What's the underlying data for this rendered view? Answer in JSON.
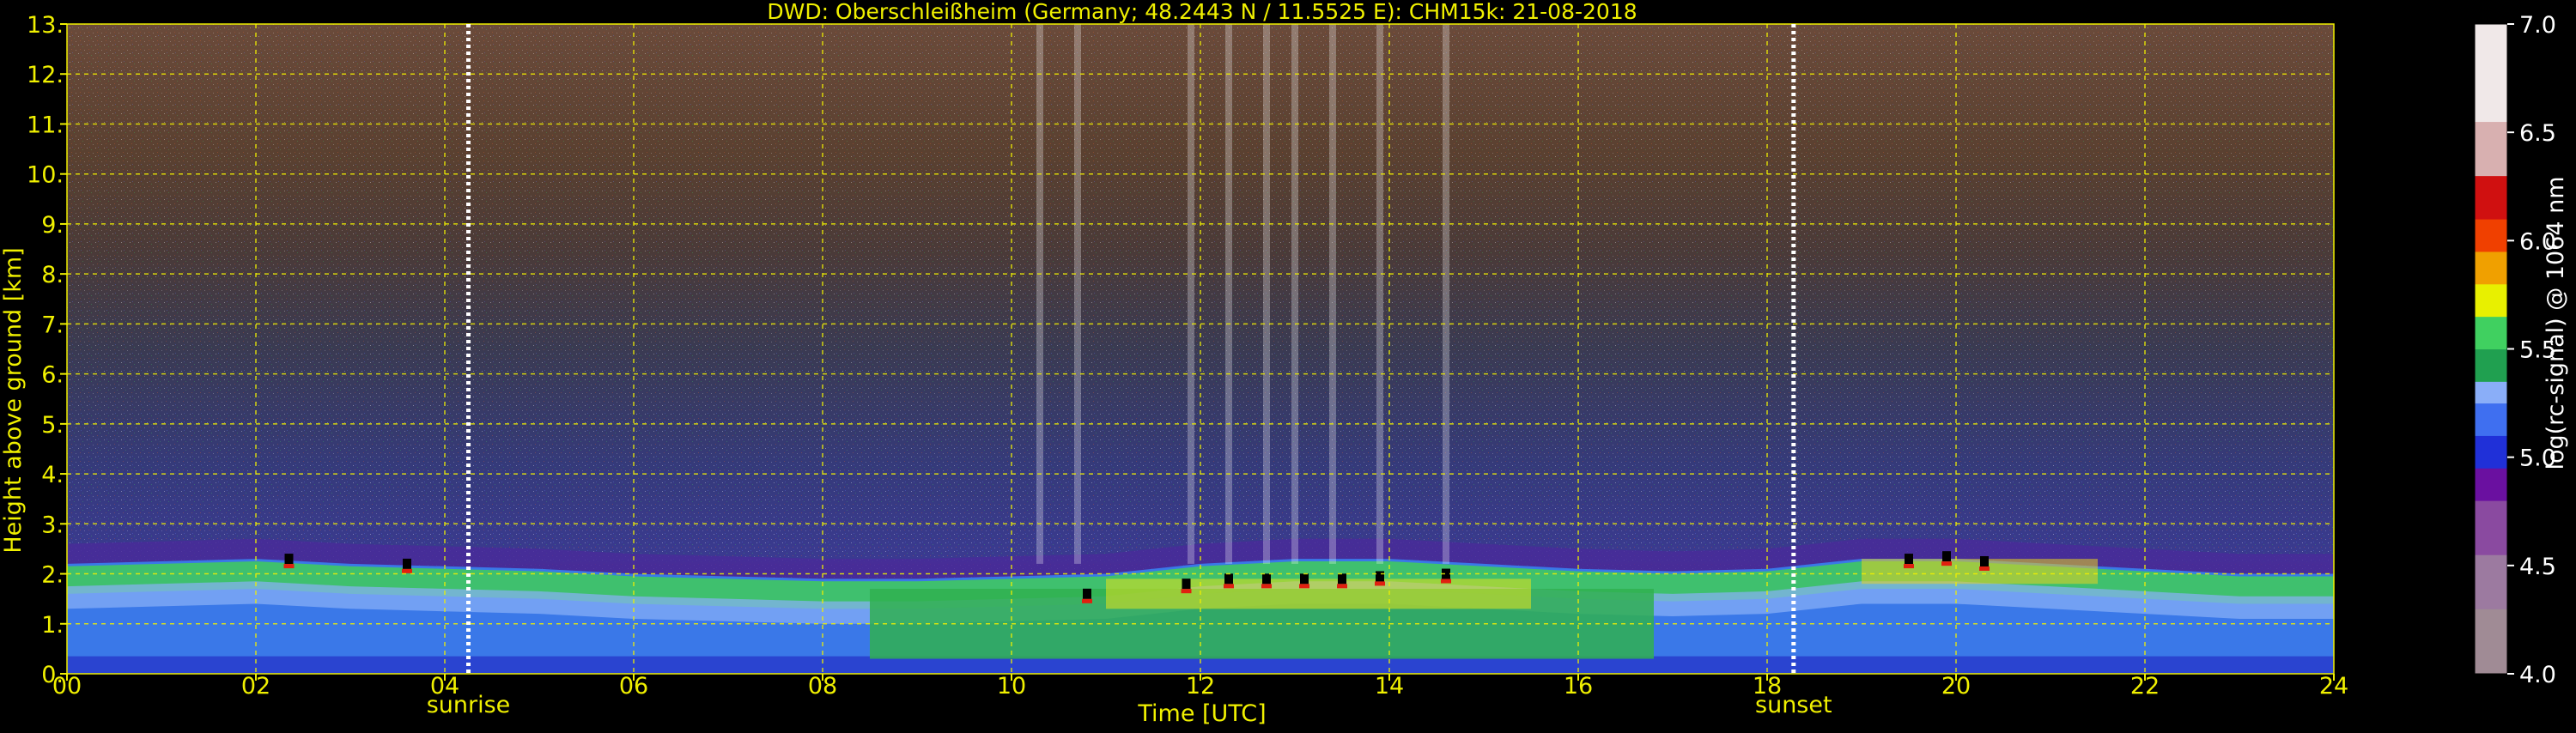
{
  "chart_data": {
    "type": "heatmap",
    "title": "DWD: Oberschleißheim (Germany; 48.2443 N / 11.5525 E):    CHM15k: 21-08-2018",
    "xlabel": "Time [UTC]",
    "ylabel": "Height above ground [km]",
    "x_range": [
      0,
      24
    ],
    "y_range": [
      0,
      13
    ],
    "x_tick_values": [
      0,
      2,
      4,
      6,
      8,
      10,
      12,
      14,
      16,
      18,
      20,
      22,
      24
    ],
    "x_tick_labels": [
      "00",
      "02",
      "04",
      "06",
      "08",
      "10",
      "12",
      "14",
      "16",
      "18",
      "20",
      "22",
      "24"
    ],
    "y_tick_values": [
      0,
      1,
      2,
      3,
      4,
      5,
      6,
      7,
      8,
      9,
      10,
      11,
      12,
      13
    ],
    "y_tick_labels": [
      "0.",
      "1.",
      "2.",
      "3.",
      "4.",
      "5.",
      "6.",
      "7.",
      "8.",
      "9.",
      "10.",
      "11.",
      "12.",
      "13."
    ],
    "grid": true,
    "annotations": [
      {
        "label": "sunrise",
        "x": 4.25
      },
      {
        "label": "sunset",
        "x": 18.28
      }
    ],
    "colorbar": {
      "label": "log(rc-signal) @ 1064 nm",
      "range": [
        4.0,
        7.0
      ],
      "tick_values": [
        4.0,
        4.5,
        5.0,
        5.5,
        6.0,
        6.5,
        7.0
      ],
      "tick_labels": [
        "4.0",
        "4.5",
        "5.0",
        "5.5",
        "6.0",
        "6.5",
        "7.0"
      ],
      "stops": [
        {
          "v": 4.0,
          "c": "#a08b95"
        },
        {
          "v": 4.3,
          "c": "#9c7aa0"
        },
        {
          "v": 4.55,
          "c": "#8a4aa0"
        },
        {
          "v": 4.8,
          "c": "#6a10a0"
        },
        {
          "v": 4.95,
          "c": "#2030d8"
        },
        {
          "v": 5.1,
          "c": "#3f6ff0"
        },
        {
          "v": 5.25,
          "c": "#8aaef8"
        },
        {
          "v": 5.35,
          "c": "#20a050"
        },
        {
          "v": 5.5,
          "c": "#40d060"
        },
        {
          "v": 5.65,
          "c": "#e8f000"
        },
        {
          "v": 5.8,
          "c": "#f0a000"
        },
        {
          "v": 5.95,
          "c": "#f04000"
        },
        {
          "v": 6.1,
          "c": "#d01010"
        },
        {
          "v": 6.3,
          "c": "#d8b0b0"
        },
        {
          "v": 6.55,
          "c": "#f0e8e8"
        },
        {
          "v": 7.0,
          "c": "#ffffff"
        }
      ]
    },
    "features": {
      "boundary_layer_top_km": [
        [
          0,
          2.2
        ],
        [
          1,
          2.25
        ],
        [
          2,
          2.3
        ],
        [
          3,
          2.2
        ],
        [
          4,
          2.15
        ],
        [
          5,
          2.1
        ],
        [
          6,
          2.0
        ],
        [
          7,
          1.95
        ],
        [
          8,
          1.9
        ],
        [
          9,
          1.9
        ],
        [
          10,
          1.95
        ],
        [
          11,
          2.0
        ],
        [
          12,
          2.2
        ],
        [
          13,
          2.3
        ],
        [
          14,
          2.3
        ],
        [
          15,
          2.2
        ],
        [
          16,
          2.1
        ],
        [
          17,
          2.05
        ],
        [
          18,
          2.1
        ],
        [
          19,
          2.3
        ],
        [
          20,
          2.3
        ],
        [
          21,
          2.2
        ],
        [
          22,
          2.1
        ],
        [
          23,
          2.0
        ],
        [
          24,
          2.0
        ]
      ],
      "cloud_base_points": [
        [
          2.35,
          2.3
        ],
        [
          3.6,
          2.2
        ],
        [
          10.8,
          1.6
        ],
        [
          11.85,
          1.8
        ],
        [
          12.3,
          1.9
        ],
        [
          12.7,
          1.9
        ],
        [
          13.1,
          1.9
        ],
        [
          13.5,
          1.9
        ],
        [
          13.9,
          1.95
        ],
        [
          14.6,
          2.0
        ],
        [
          19.5,
          2.3
        ],
        [
          19.9,
          2.35
        ],
        [
          20.3,
          2.25
        ]
      ],
      "precip_streaks_x": [
        10.3,
        10.7,
        11.9,
        12.3,
        12.7,
        13.0,
        13.4,
        13.9,
        14.6
      ]
    },
    "colors": {
      "text": "#f0f000",
      "grid": "#f0f000",
      "colorbar_text": "#ffffff",
      "background": "#000000"
    }
  }
}
